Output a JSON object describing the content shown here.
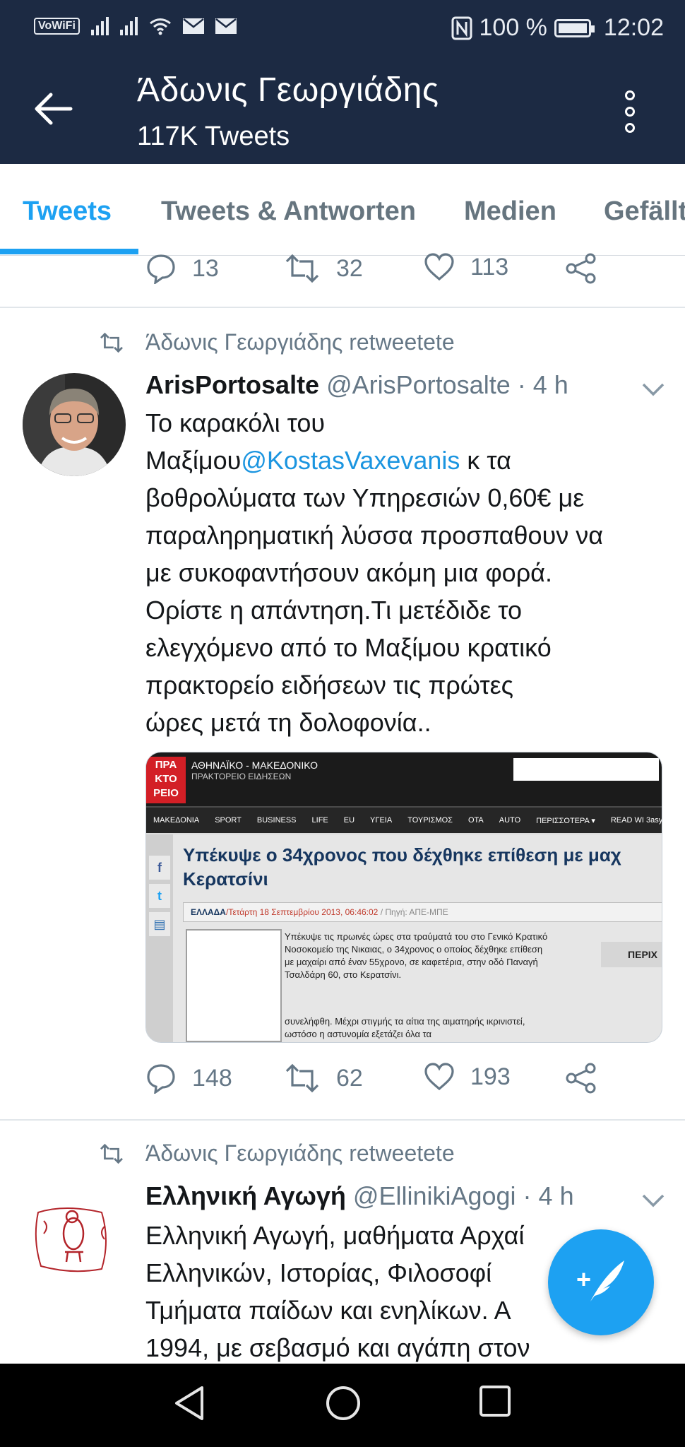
{
  "status_bar": {
    "vowifi": "VoWiFi",
    "battery": "100 %",
    "time": "12:02"
  },
  "header": {
    "title": "Άδωνις Γεωργιάδης",
    "subtitle": "117K Tweets",
    "back_icon": "arrow-left-icon",
    "menu_icon": "more-vertical-icon"
  },
  "tabs": [
    {
      "label": "Tweets",
      "active": true
    },
    {
      "label": "Tweets & Antworten",
      "active": false
    },
    {
      "label": "Medien",
      "active": false
    },
    {
      "label": "Gefällt",
      "active": false
    }
  ],
  "tweet0_actions": {
    "replies": "13",
    "retweets": "32",
    "likes": "113"
  },
  "tweet1": {
    "retweeted_by": "Άδωνις Γεωργιάδης retweetete",
    "name": "ArisPortosalte",
    "handle_time": " @ArisPortosalte · 4 h",
    "lines": [
      "Το καρακόλι του",
      "Μαξίμου",
      "@KostasVaxevanis",
      " κ τα",
      "βοθρολύματα των Υπηρεσιών 0,60€ με",
      "παραληρηματική λύσσα προσπαθουν να",
      "με συκοφαντήσουν ακόμη μια φορά.",
      "Ορίστε η απάντηση.Τι μετέδιδε το",
      "ελεγχόμενο από το Μαξίμου κρατικό",
      "πρακτορείο ειδήσεων τις πρώτες",
      "ώρες μετά τη δολοφονία.."
    ],
    "replies": "148",
    "retweets": "62",
    "likes": "193",
    "card": {
      "logo": [
        "ΠΡΑ",
        "ΚΤΟ",
        "ΡΕΙΟ"
      ],
      "agency": "ΑΘΗΝΑΪΚΟ - ΜΑΚΕΔΟΝΙΚΟ",
      "agency_sub": "ΠΡΑΚΤΟΡΕΙΟ ΕΙΔΗΣΕΩΝ",
      "nav": [
        "ΜΑΚΕΔΟΝΙΑ",
        "SPORT",
        "BUSINESS",
        "LIFE",
        "EU",
        "ΥΓΕΙΑ",
        "ΤΟΥΡΙΣΜΟΣ",
        "ΟΤΑ",
        "AUTO",
        "ΠΕΡΙΣΣΟΤΕΡΑ ▾"
      ],
      "read_label": "READ WI",
      "read_brand": "3asy",
      "headline": "Υπέκυψε ο 34χρονος που δέχθηκε επίθεση με μαχ",
      "headline2": "Κερατσίνι",
      "category": "ΕΛΛΑΔΑ",
      "date": "/Τετάρτη 18 Σεπτεμβρίου 2013, 06:46:02",
      "source": " / Πηγή: ΑΠΕ-ΜΠΕ",
      "article": "Υπέκυψε τις πρωινές ώρες στα τραύματά του στο Γενικό Κρατικό Νοσοκομείο της Νικαιας, ο 34χρονος ο οποίος δέχθηκε επίθεση με μαχαίρι από έναν 55χρονο, σε καφετέρια, στην οδό Παναγή Τσαλδάρη 60, στο Κερατσίνι.",
      "article2": "συνελήφθη. Μέχρι στιγμής τα αίτια της αιματηρής ικρινιστεί, ωστόσο η αστυνομία εξετάζει όλα τα",
      "side_label": "ΠΕΡΙΧ"
    }
  },
  "tweet2": {
    "retweeted_by": "Άδωνις Γεωργιάδης retweetete",
    "name": "Ελληνική Αγωγή",
    "handle_time": " @EllinikiAgogi · 4 h",
    "lines": [
      "Ελληνική Αγωγή, μαθήματα Αρχαί",
      "Ελληνικών, Ιστορίας, Φιλοσοφί",
      "Τμήματα παίδων και ενηλίκων. Α",
      "1994, με σεβασμό και αγάπη στον"
    ]
  },
  "colors": {
    "header_bg": "#1c2a43",
    "accent": "#1da1f2",
    "link": "#1b95e0",
    "muted": "#657786"
  },
  "icons": {
    "reply": "reply-icon",
    "retweet": "retweet-icon",
    "like": "heart-icon",
    "share": "share-icon",
    "compose": "compose-tweet-icon",
    "caret": "chevron-down-icon"
  },
  "system_nav": [
    "back-triangle-icon",
    "home-circle-icon",
    "recents-square-icon"
  ]
}
